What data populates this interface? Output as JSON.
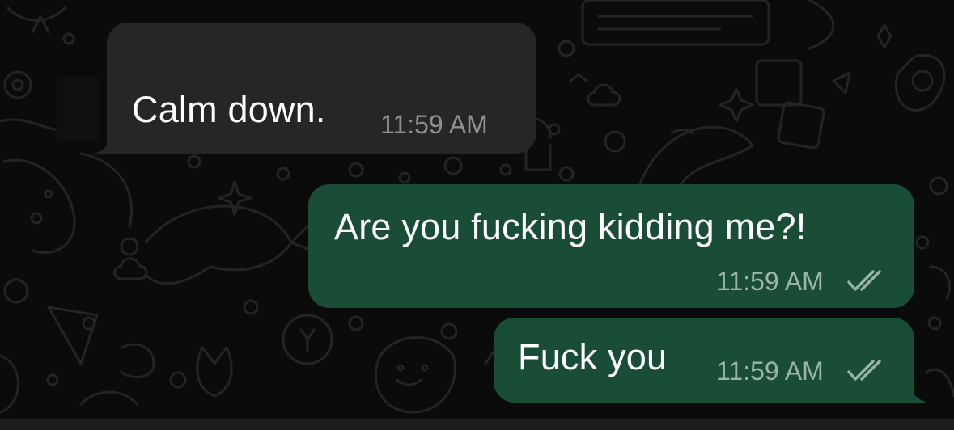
{
  "messages": [
    {
      "direction": "incoming",
      "text": "Calm down.",
      "time": "11:59 AM"
    },
    {
      "direction": "outgoing",
      "text": "Are you fucking kidding me?!",
      "time": "11:59 AM",
      "status_icon": "double-check-icon"
    },
    {
      "direction": "outgoing",
      "text": "Fuck you",
      "time": "11:59 AM",
      "status_icon": "double-check-icon"
    }
  ],
  "colors": {
    "background": "#0b0b0b",
    "incoming_bubble": "#262628",
    "outgoing_bubble": "#1a4d36",
    "text": "#ffffff",
    "incoming_time": "#8e8e92",
    "outgoing_time": "#9ab5a6"
  }
}
